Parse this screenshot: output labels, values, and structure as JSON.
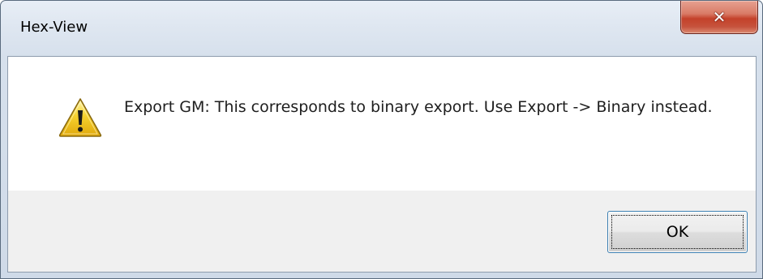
{
  "window": {
    "title": "Hex-View",
    "close_icon": "close-icon",
    "close_glyph": "✕"
  },
  "message": {
    "icon": "warning-icon",
    "text": "Export GM: This corresponds to binary export. Use Export -> Binary instead."
  },
  "buttons": {
    "ok_label": "OK"
  },
  "colors": {
    "close_button": "#c4412a",
    "warning_fill": "#f6d22f",
    "button_panel": "#f0f0f0",
    "focus_border": "#3c7fb1"
  }
}
